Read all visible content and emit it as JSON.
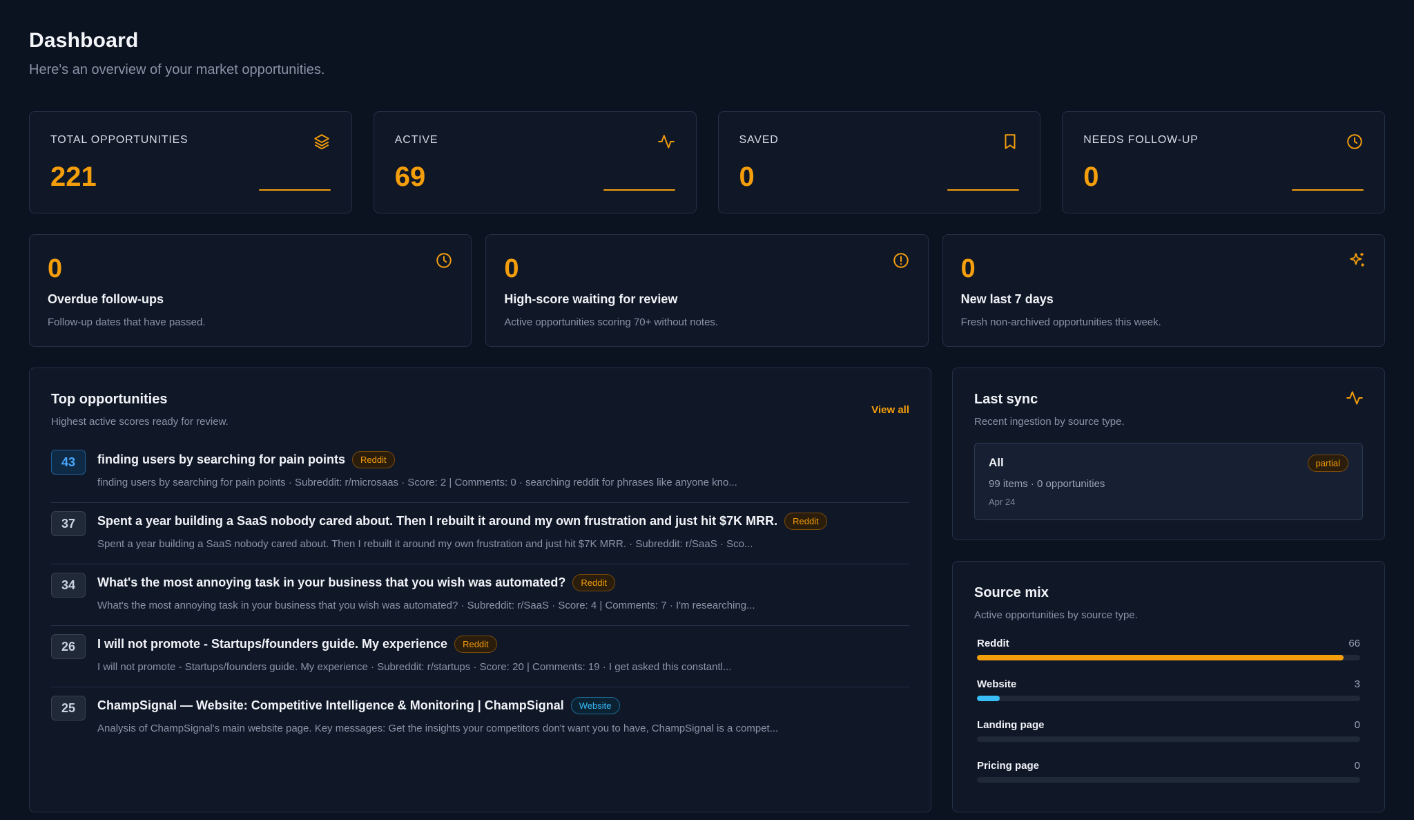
{
  "header": {
    "title": "Dashboard",
    "subtitle": "Here's an overview of your market opportunities."
  },
  "stats": [
    {
      "label": "TOTAL OPPORTUNITIES",
      "value": "221",
      "icon": "layers-icon"
    },
    {
      "label": "ACTIVE",
      "value": "69",
      "icon": "activity-icon"
    },
    {
      "label": "SAVED",
      "value": "0",
      "icon": "bookmark-icon"
    },
    {
      "label": "NEEDS FOLLOW-UP",
      "value": "0",
      "icon": "clock-icon"
    }
  ],
  "alerts": [
    {
      "value": "0",
      "title": "Overdue follow-ups",
      "desc": "Follow-up dates that have passed.",
      "icon": "clock-icon"
    },
    {
      "value": "0",
      "title": "High-score waiting for review",
      "desc": "Active opportunities scoring 70+ without notes.",
      "icon": "alert-circle-icon"
    },
    {
      "value": "0",
      "title": "New last 7 days",
      "desc": "Fresh non-archived opportunities this week.",
      "icon": "sparkles-icon"
    }
  ],
  "top_opportunities": {
    "title": "Top opportunities",
    "subtitle": "Highest active scores ready for review.",
    "view_all": "View all",
    "items": [
      {
        "score": "43",
        "title": "finding users by searching for pain points",
        "tag": "Reddit",
        "desc": "finding users by searching for pain points · Subreddit: r/microsaas · Score: 2 | Comments: 0 · searching reddit for phrases like anyone kno..."
      },
      {
        "score": "37",
        "title": "Spent a year building a SaaS nobody cared about. Then I rebuilt it around my own frustration and just hit $7K MRR.",
        "tag": "Reddit",
        "desc": "Spent a year building a SaaS nobody cared about. Then I rebuilt it around my own frustration and just hit $7K MRR. · Subreddit: r/SaaS · Sco..."
      },
      {
        "score": "34",
        "title": "What's the most annoying task in your business that you wish was automated?",
        "tag": "Reddit",
        "desc": "What's the most annoying task in your business that you wish was automated? · Subreddit: r/SaaS · Score: 4 | Comments: 7 · I'm researching..."
      },
      {
        "score": "26",
        "title": "I will not promote - Startups/founders guide. My experience",
        "tag": "Reddit",
        "desc": "I will not promote - Startups/founders guide. My experience · Subreddit: r/startups · Score: 20 | Comments: 19 · I get asked this constantl..."
      },
      {
        "score": "25",
        "title": "ChampSignal — Website: Competitive Intelligence & Monitoring | ChampSignal",
        "tag": "Website",
        "desc": "Analysis of ChampSignal's main website page. Key messages: Get the insights your competitors don't want you to have, ChampSignal is a compet..."
      }
    ]
  },
  "last_sync": {
    "title": "Last sync",
    "subtitle": "Recent ingestion by source type.",
    "name": "All",
    "badge": "partial",
    "meta": "99 items · 0 opportunities",
    "date": "Apr 24"
  },
  "source_mix": {
    "title": "Source mix",
    "subtitle": "Active opportunities by source type.",
    "rows": [
      {
        "label": "Reddit",
        "count": "66",
        "fraction": 0.957,
        "color": "#f59e0b"
      },
      {
        "label": "Website",
        "count": "3",
        "fraction": 0.06,
        "color": "#38bdf8"
      },
      {
        "label": "Landing page",
        "count": "0",
        "fraction": 0,
        "color": "#f59e0b"
      },
      {
        "label": "Pricing page",
        "count": "0",
        "fraction": 0,
        "color": "#f59e0b"
      }
    ]
  }
}
